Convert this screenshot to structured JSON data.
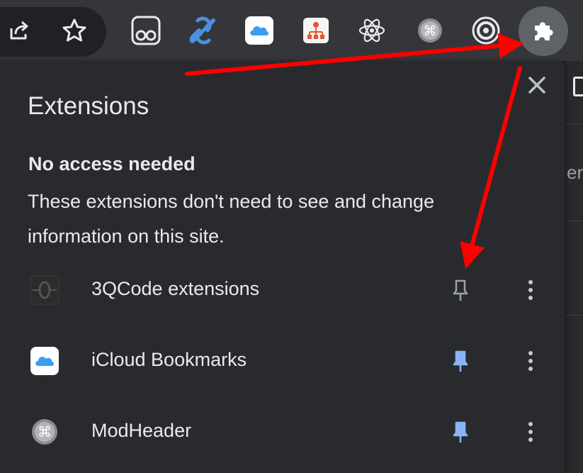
{
  "toolbar": {
    "icons": [
      "share-icon",
      "star-icon",
      "tampermonkey-icon",
      "link-icon",
      "icloud-icon",
      "sitemap-icon",
      "react-icon",
      "modheader-icon",
      "target-icon",
      "puzzle-icon"
    ]
  },
  "popup": {
    "title": "Extensions",
    "section_heading": "No access needed",
    "section_description": "These extensions don't need to see and change information on this site.",
    "extensions": [
      {
        "name": "3QCode extensions",
        "icon": "3qcode-icon",
        "pinned": false
      },
      {
        "name": "iCloud Bookmarks",
        "icon": "icloud-icon",
        "pinned": true
      },
      {
        "name": "ModHeader",
        "icon": "modheader-icon",
        "pinned": true
      }
    ]
  },
  "page_behind": {
    "partial_text": "er"
  },
  "colors": {
    "annotation_arrow": "#ff0000",
    "pin_active": "#8ab4f8",
    "pin_inactive": "#9aa0a6"
  }
}
